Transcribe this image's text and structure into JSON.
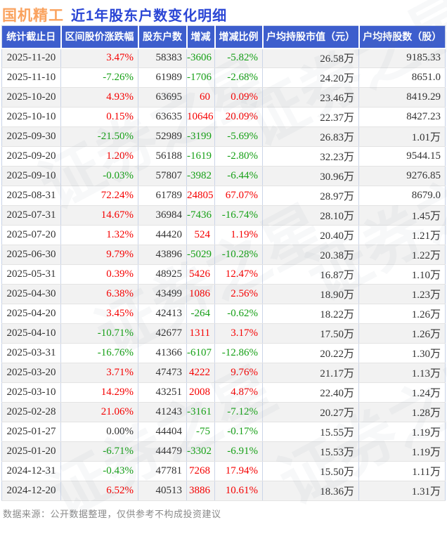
{
  "page": {
    "title_stock": "国机精工",
    "title_text": "近1年股东户数变化明细",
    "footer": "数据来源：公开数据整理，仅供参考不构成投资建议",
    "watermark": "证券之星"
  },
  "colors": {
    "title_stock_orange": "#faa25e",
    "title_blue": "#2b46d5",
    "header_bg_blue": "#3d5ecd",
    "header_text": "#ffffff",
    "up_red": "#f50000",
    "down_green": "#16a016",
    "neutral_text": "#333333",
    "row_stripe": "#f2f2f2",
    "vertical_border": "#ccd5e8",
    "horizontal_border": "#e3e3e3",
    "footer_gray": "#8a8a8a"
  },
  "chart_data": {
    "type": "table",
    "title": "国机精工 近1年股东户数变化明细",
    "columns": [
      "统计截止日",
      "区间股价涨跌幅",
      "股东户数",
      "增减",
      "增减比例",
      "户均持股市值（元）",
      "户均持股数（股）"
    ],
    "rows": [
      {
        "date": "2025-11-20",
        "range_change": "3.47%",
        "range_trend": "up",
        "holders": "58383",
        "delta": "-3606",
        "delta_trend": "down",
        "delta_pct": "-5.82%",
        "avg_value": "26.58万",
        "avg_shares": "9185.33"
      },
      {
        "date": "2025-11-10",
        "range_change": "-7.26%",
        "range_trend": "down",
        "holders": "61989",
        "delta": "-1706",
        "delta_trend": "down",
        "delta_pct": "-2.68%",
        "avg_value": "24.20万",
        "avg_shares": "8651.0"
      },
      {
        "date": "2025-10-20",
        "range_change": "4.93%",
        "range_trend": "up",
        "holders": "63695",
        "delta": "60",
        "delta_trend": "up",
        "delta_pct": "0.09%",
        "avg_value": "23.46万",
        "avg_shares": "8419.29"
      },
      {
        "date": "2025-10-10",
        "range_change": "0.15%",
        "range_trend": "up",
        "holders": "63635",
        "delta": "10646",
        "delta_trend": "up",
        "delta_pct": "20.09%",
        "avg_value": "22.37万",
        "avg_shares": "8427.23"
      },
      {
        "date": "2025-09-30",
        "range_change": "-21.50%",
        "range_trend": "down",
        "holders": "52989",
        "delta": "-3199",
        "delta_trend": "down",
        "delta_pct": "-5.69%",
        "avg_value": "26.83万",
        "avg_shares": "1.01万"
      },
      {
        "date": "2025-09-20",
        "range_change": "1.20%",
        "range_trend": "up",
        "holders": "56188",
        "delta": "-1619",
        "delta_trend": "down",
        "delta_pct": "-2.80%",
        "avg_value": "32.23万",
        "avg_shares": "9544.15"
      },
      {
        "date": "2025-09-10",
        "range_change": "-0.03%",
        "range_trend": "down",
        "holders": "57807",
        "delta": "-3982",
        "delta_trend": "down",
        "delta_pct": "-6.44%",
        "avg_value": "30.96万",
        "avg_shares": "9276.85"
      },
      {
        "date": "2025-08-31",
        "range_change": "72.24%",
        "range_trend": "up",
        "holders": "61789",
        "delta": "24805",
        "delta_trend": "up",
        "delta_pct": "67.07%",
        "avg_value": "28.97万",
        "avg_shares": "8679.0"
      },
      {
        "date": "2025-07-31",
        "range_change": "14.67%",
        "range_trend": "up",
        "holders": "36984",
        "delta": "-7436",
        "delta_trend": "down",
        "delta_pct": "-16.74%",
        "avg_value": "28.10万",
        "avg_shares": "1.45万"
      },
      {
        "date": "2025-07-20",
        "range_change": "1.32%",
        "range_trend": "up",
        "holders": "44420",
        "delta": "524",
        "delta_trend": "up",
        "delta_pct": "1.19%",
        "avg_value": "20.40万",
        "avg_shares": "1.21万"
      },
      {
        "date": "2025-06-30",
        "range_change": "9.79%",
        "range_trend": "up",
        "holders": "43896",
        "delta": "-5029",
        "delta_trend": "down",
        "delta_pct": "-10.28%",
        "avg_value": "20.38万",
        "avg_shares": "1.22万"
      },
      {
        "date": "2025-05-31",
        "range_change": "0.39%",
        "range_trend": "up",
        "holders": "48925",
        "delta": "5426",
        "delta_trend": "up",
        "delta_pct": "12.47%",
        "avg_value": "16.87万",
        "avg_shares": "1.10万"
      },
      {
        "date": "2025-04-30",
        "range_change": "6.38%",
        "range_trend": "up",
        "holders": "43499",
        "delta": "1086",
        "delta_trend": "up",
        "delta_pct": "2.56%",
        "avg_value": "18.90万",
        "avg_shares": "1.23万"
      },
      {
        "date": "2025-04-20",
        "range_change": "3.45%",
        "range_trend": "up",
        "holders": "42413",
        "delta": "-264",
        "delta_trend": "down",
        "delta_pct": "-0.62%",
        "avg_value": "18.22万",
        "avg_shares": "1.26万"
      },
      {
        "date": "2025-04-10",
        "range_change": "-10.71%",
        "range_trend": "down",
        "holders": "42677",
        "delta": "1311",
        "delta_trend": "up",
        "delta_pct": "3.17%",
        "avg_value": "17.50万",
        "avg_shares": "1.26万"
      },
      {
        "date": "2025-03-31",
        "range_change": "-16.76%",
        "range_trend": "down",
        "holders": "41366",
        "delta": "-6107",
        "delta_trend": "down",
        "delta_pct": "-12.86%",
        "avg_value": "20.22万",
        "avg_shares": "1.30万"
      },
      {
        "date": "2025-03-20",
        "range_change": "3.71%",
        "range_trend": "up",
        "holders": "47473",
        "delta": "4222",
        "delta_trend": "up",
        "delta_pct": "9.76%",
        "avg_value": "21.17万",
        "avg_shares": "1.13万"
      },
      {
        "date": "2025-03-10",
        "range_change": "14.29%",
        "range_trend": "up",
        "holders": "43251",
        "delta": "2008",
        "delta_trend": "up",
        "delta_pct": "4.87%",
        "avg_value": "22.40万",
        "avg_shares": "1.24万"
      },
      {
        "date": "2025-02-28",
        "range_change": "21.06%",
        "range_trend": "up",
        "holders": "41243",
        "delta": "-3161",
        "delta_trend": "down",
        "delta_pct": "-7.12%",
        "avg_value": "20.27万",
        "avg_shares": "1.28万"
      },
      {
        "date": "2025-01-27",
        "range_change": "0.00%",
        "range_trend": "flat",
        "holders": "44404",
        "delta": "-75",
        "delta_trend": "down",
        "delta_pct": "-0.17%",
        "avg_value": "15.55万",
        "avg_shares": "1.19万"
      },
      {
        "date": "2025-01-20",
        "range_change": "-6.71%",
        "range_trend": "down",
        "holders": "44479",
        "delta": "-3302",
        "delta_trend": "down",
        "delta_pct": "-6.91%",
        "avg_value": "15.53万",
        "avg_shares": "1.19万"
      },
      {
        "date": "2024-12-31",
        "range_change": "-0.43%",
        "range_trend": "down",
        "holders": "47781",
        "delta": "7268",
        "delta_trend": "up",
        "delta_pct": "17.94%",
        "avg_value": "15.50万",
        "avg_shares": "1.11万"
      },
      {
        "date": "2024-12-20",
        "range_change": "6.52%",
        "range_trend": "up",
        "holders": "40513",
        "delta": "3886",
        "delta_trend": "up",
        "delta_pct": "10.61%",
        "avg_value": "18.36万",
        "avg_shares": "1.31万"
      }
    ]
  }
}
